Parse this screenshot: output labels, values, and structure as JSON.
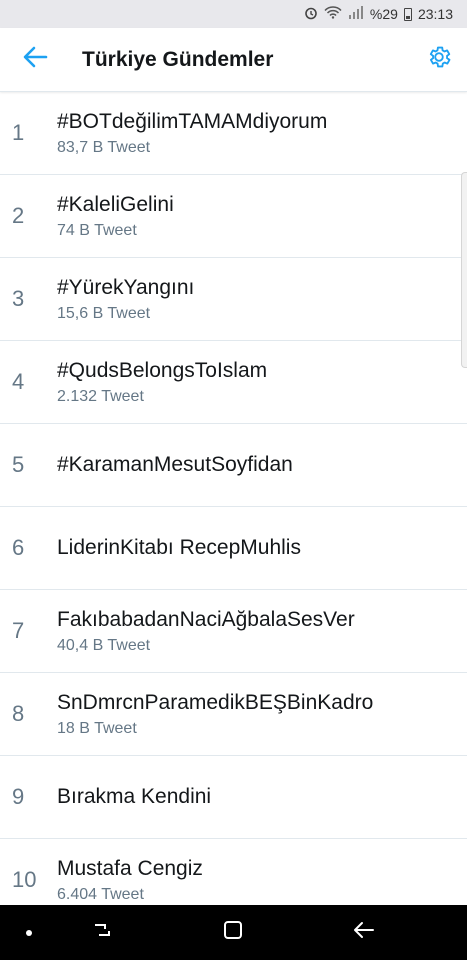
{
  "status_bar": {
    "battery_percent": "%29",
    "time": "23:13"
  },
  "header": {
    "title": "Türkiye Gündemler"
  },
  "trends": [
    {
      "rank": "1",
      "name": "#BOTdeğilimTAMAMdiyorum",
      "count": "83,7 B Tweet"
    },
    {
      "rank": "2",
      "name": "#KaleliGelini",
      "count": "74 B Tweet"
    },
    {
      "rank": "3",
      "name": "#YürekYangını",
      "count": "15,6 B Tweet"
    },
    {
      "rank": "4",
      "name": "#QudsBelongsToIslam",
      "count": "2.132 Tweet"
    },
    {
      "rank": "5",
      "name": "#KaramanMesutSoyfidan",
      "count": ""
    },
    {
      "rank": "6",
      "name": "LiderinKitabı RecepMuhlis",
      "count": ""
    },
    {
      "rank": "7",
      "name": "FakıbabadanNaciAğbalaSesVer",
      "count": "40,4 B Tweet"
    },
    {
      "rank": "8",
      "name": "SnDmrcnParamedikBEŞBinKadro",
      "count": "18 B Tweet"
    },
    {
      "rank": "9",
      "name": "Bırakma Kendini",
      "count": ""
    },
    {
      "rank": "10",
      "name": "Mustafa Cengiz",
      "count": "6.404 Tweet"
    }
  ],
  "colors": {
    "accent": "#1da1f2",
    "text_primary": "#14171a",
    "text_secondary": "#657786"
  },
  "icons": {
    "back": "arrow-left-icon",
    "settings": "gear-icon"
  }
}
